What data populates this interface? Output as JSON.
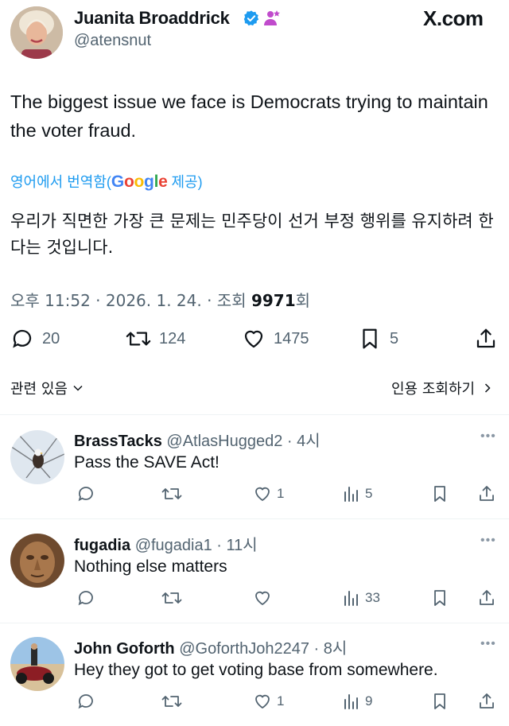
{
  "tweet": {
    "author_name": "Juanita Broaddrick",
    "author_handle": "@atensnut",
    "site": "X.com",
    "text": "The biggest issue we face is Democrats trying to maintain the voter fraud.",
    "translate_prefix": "영어에서 번역함(",
    "translate_google": "Google",
    "translate_suffix": " 제공)",
    "translated_text": "우리가 직면한 가장 큰 문제는 민주당이 선거 부정 행위를 유지하려 한다는 것입니다.",
    "time": "오후 11:52 · 2026. 1. 24. · 조회 ",
    "views": "9971",
    "views_suffix": "회",
    "replies": "20",
    "reposts": "124",
    "likes": "1475",
    "bookmarks": "5"
  },
  "related": {
    "label": "관련 있음",
    "quotes_label": "인용 조회하기"
  },
  "replies": [
    {
      "name": "BrassTacks",
      "handle": "@AtlasHugged2 · 4시",
      "text": "Pass the SAVE Act!",
      "likes": "1",
      "views": "5"
    },
    {
      "name": "fugadia",
      "handle": "@fugadia1 · 11시",
      "text": "Nothing else matters",
      "likes": "",
      "views": "33"
    },
    {
      "name": "John Goforth",
      "handle": "@GoforthJoh2247 · 8시",
      "text": "Hey they got to get voting base from somewhere.",
      "likes": "1",
      "views": "9"
    }
  ],
  "colors": {
    "accent": "#1d9bf0",
    "text": "#0f1419",
    "muted": "#536471",
    "verified": "#1d9bf0",
    "org_badge": "#c04bcc"
  },
  "icons": [
    "verified-badge-icon",
    "org-badge-icon",
    "reply-icon",
    "repost-icon",
    "like-icon",
    "bookmark-icon",
    "share-icon",
    "views-icon",
    "chevron-down-icon",
    "chevron-right-icon",
    "more-icon"
  ]
}
